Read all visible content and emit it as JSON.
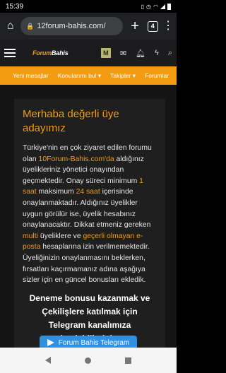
{
  "status_bar": {
    "time": "15:39",
    "icons": [
      "vibrate-icon",
      "alarm-icon",
      "wifi-icon",
      "signal-icon",
      "battery-icon"
    ]
  },
  "browser": {
    "url": "12forum-bahis.com/",
    "tab_count": "4"
  },
  "site": {
    "logo_prefix": "Forum",
    "logo_suffix": "Bahis",
    "avatar_letter": "M",
    "nav": [
      "Yeni mesajlar",
      "Konularımı bul ▾",
      "Takipler ▾",
      "Forumlar"
    ]
  },
  "content": {
    "title": "Merhaba değerli üye adayımız",
    "p1": "Türkiye'nin en çok ziyaret edilen forumu olan ",
    "p_site": "10Forum-Bahis.com'da",
    "p2": " aldığınız üyelikleriniz yönetici onayından geçmektedir. Onay süreci minimum ",
    "p_min": "1 saat",
    "p3": " maksimum ",
    "p_max": "24 saat",
    "p4": " içerisinde onaylanmaktadır. Aldığınız üyelikler uygun görülür ise, üyelik hesabınız onaylanacaktır. Dikkat etmeniz gereken ",
    "p_multi": "multi",
    "p5": " üyeliklere ve ",
    "p_invalid": "geçerli olmayan e-posta",
    "p6": " hesaplarına izin verilmemektedir. Üyeliğinizin onaylanmasını beklerken, fırsatları kaçırmamanız adına aşağıya sizler için en güncel bonusları ekledik.",
    "promo": "Deneme bonusu kazanmak ve Çekilişlere katılmak için Telegram kanalımıza katılabilirsiniz.",
    "telegram_button": "Forum Bahis Telegram"
  },
  "colors": {
    "accent": "#f39c12",
    "telegram": "#2f8fe0",
    "card": "#1f1f1f",
    "background": "#141414"
  }
}
